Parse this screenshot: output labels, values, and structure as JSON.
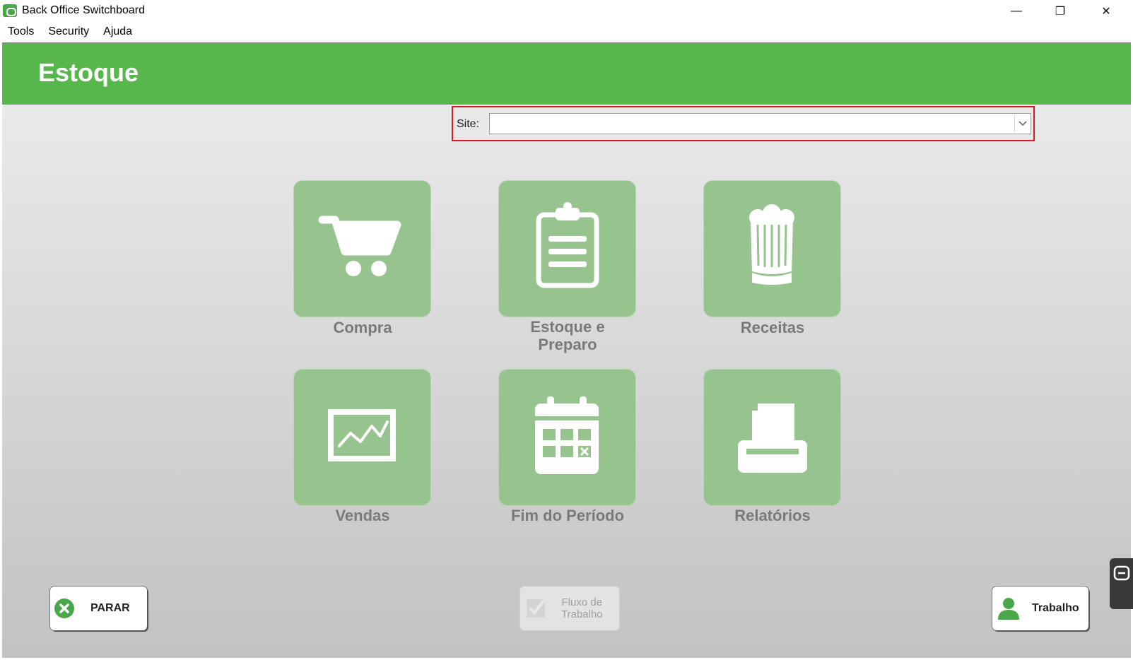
{
  "window": {
    "title": "Back Office Switchboard",
    "controls": {
      "minimize": "—",
      "maximize": "❐",
      "close": "✕"
    }
  },
  "menu": [
    "Tools",
    "Security",
    "Ajuda"
  ],
  "header": {
    "title": "Estoque",
    "color": "#57b74d"
  },
  "site": {
    "label": "Site:",
    "value": ""
  },
  "tiles": [
    {
      "label": "Compra",
      "icon": "shopping-cart-icon"
    },
    {
      "label": "Estoque e Preparo",
      "icon": "clipboard-icon"
    },
    {
      "label": "Receitas",
      "icon": "chef-hat-icon"
    },
    {
      "label": "Vendas",
      "icon": "sales-chart-icon"
    },
    {
      "label": "Fim do Período",
      "icon": "calendar-icon"
    },
    {
      "label": "Relatórios",
      "icon": "printer-icon"
    }
  ],
  "buttons": {
    "stop": "PARAR",
    "workflow_line1": "Fluxo de",
    "workflow_line2": "Trabalho",
    "work": "Trabalho"
  },
  "colors": {
    "tile": "#96c38e",
    "accent": "#4aa84a",
    "highlight": "#e0141c"
  }
}
